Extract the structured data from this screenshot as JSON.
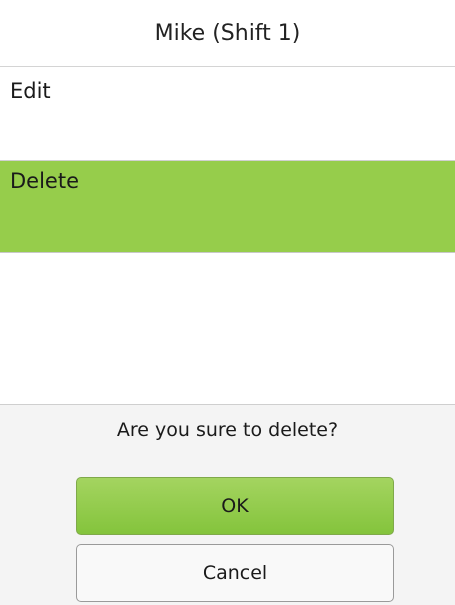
{
  "header": {
    "title": "Mike (Shift 1)"
  },
  "menu": {
    "items": [
      {
        "label": "Edit",
        "selected": false
      },
      {
        "label": "Delete",
        "selected": true
      }
    ]
  },
  "dialog": {
    "message": "Are you sure to delete?",
    "ok_label": "OK",
    "cancel_label": "Cancel"
  },
  "colors": {
    "selected_bg": "#96cd4b",
    "ok_button": "#8cc843",
    "background": "#ffffff"
  }
}
